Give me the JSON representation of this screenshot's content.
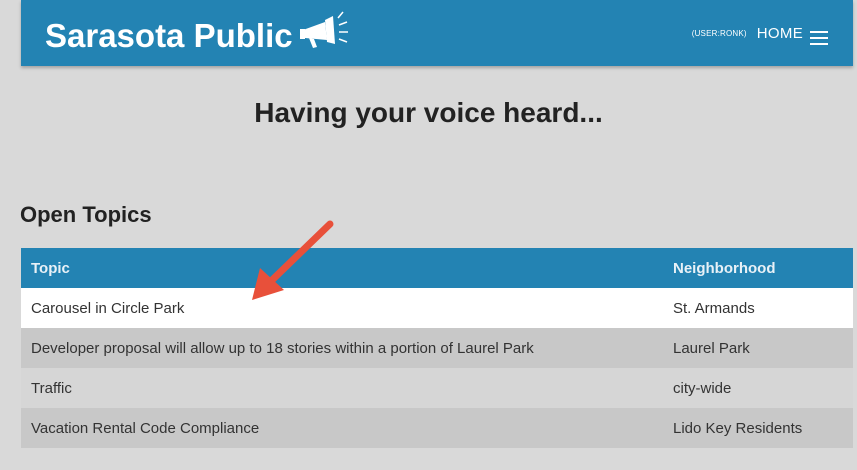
{
  "header": {
    "brand": "Sarasota Public",
    "user_tag": "(USER:RONK)",
    "home_label": "HOME"
  },
  "main": {
    "headline": "Having your voice heard...",
    "section_title": "Open Topics"
  },
  "table": {
    "columns": [
      "Topic",
      "Neighborhood"
    ],
    "rows": [
      {
        "topic": "Carousel in Circle Park",
        "neighborhood": "St. Armands"
      },
      {
        "topic": "Developer proposal will allow up to 18 stories within a portion of Laurel Park",
        "neighborhood": "Laurel Park"
      },
      {
        "topic": "Traffic",
        "neighborhood": "city-wide"
      },
      {
        "topic": "Vacation Rental Code Compliance",
        "neighborhood": "Lido Key Residents"
      }
    ]
  },
  "colors": {
    "brand_blue": "#2383b3",
    "page_bg": "#d9d9d9",
    "arrow_red": "#e8503a"
  },
  "icons": [
    "megaphone-icon",
    "hamburger-menu-icon",
    "annotation-arrow"
  ]
}
